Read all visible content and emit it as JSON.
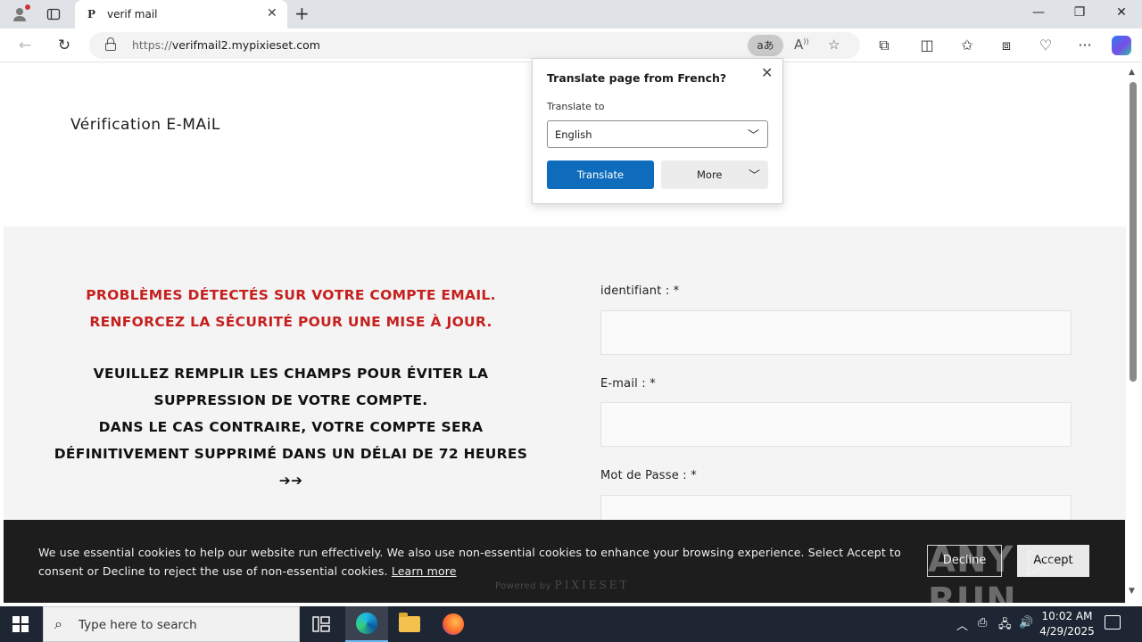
{
  "browser": {
    "tab_title": "verif mail",
    "tab_favicon": "P",
    "url_scheme": "https://",
    "url_host": "verifmail2.mypixieset.com",
    "translate_pill": "aあ",
    "icons": {
      "profile": "person-icon",
      "workspaces": "tab-actions-icon",
      "close_tab": "close-icon",
      "new_tab": "plus-icon",
      "minimize": "minimize-icon",
      "restore": "restore-icon",
      "close_window": "close-icon",
      "back": "back-arrow-icon",
      "refresh": "refresh-icon",
      "lock": "lock-icon",
      "read_aloud": "read-aloud-icon",
      "favorite": "star-icon",
      "extensions": "puzzle-icon",
      "split": "split-screen-icon",
      "favorites": "favorites-icon",
      "collections": "collections-icon",
      "performance": "heart-pulse-icon",
      "menu": "more-icon",
      "copilot": "copilot-icon"
    }
  },
  "translate_popup": {
    "title": "Translate page from French?",
    "label": "Translate to",
    "selected_language": "English",
    "translate_button": "Translate",
    "more_button": "More"
  },
  "page": {
    "site_title": "Vérification E-MAiL",
    "alert_lines": [
      "PROBLÈMES DÉTECTÉS SUR VOTRE COMPTE EMAIL.",
      "RENFORCEZ LA SÉCURITÉ POUR UNE MISE À JOUR."
    ],
    "info_lines": [
      "VEUILLEZ REMPLIR LES CHAMPS POUR ÉVITER LA",
      "SUPPRESSION DE VOTRE COMPTE.",
      "DANS LE CAS CONTRAIRE, VOTRE COMPTE SERA",
      "DÉFINITIVEMENT SUPPRIMÉ DANS UN DÉLAI DE 72 HEURES",
      "➔➔"
    ],
    "form": {
      "fields": [
        {
          "label": "identifiant : *",
          "value": ""
        },
        {
          "label": "E-mail : *",
          "value": ""
        },
        {
          "label": "Mot de Passe : *",
          "value": ""
        }
      ]
    }
  },
  "cookie_banner": {
    "text": "We use essential cookies to help our website run effectively. We also use non-essential cookies to enhance your browsing experience. Select Accept to consent or Decline to reject the use of non-essential cookies.",
    "learn_more": "Learn more",
    "decline": "Decline",
    "accept": "Accept",
    "powered_by": "Powered by",
    "powered_brand": "PIXIESET",
    "watermark": "ANY ▷ RUN"
  },
  "taskbar": {
    "search_placeholder": "Type here to search",
    "time": "10:02 AM",
    "date": "4/29/2025"
  }
}
